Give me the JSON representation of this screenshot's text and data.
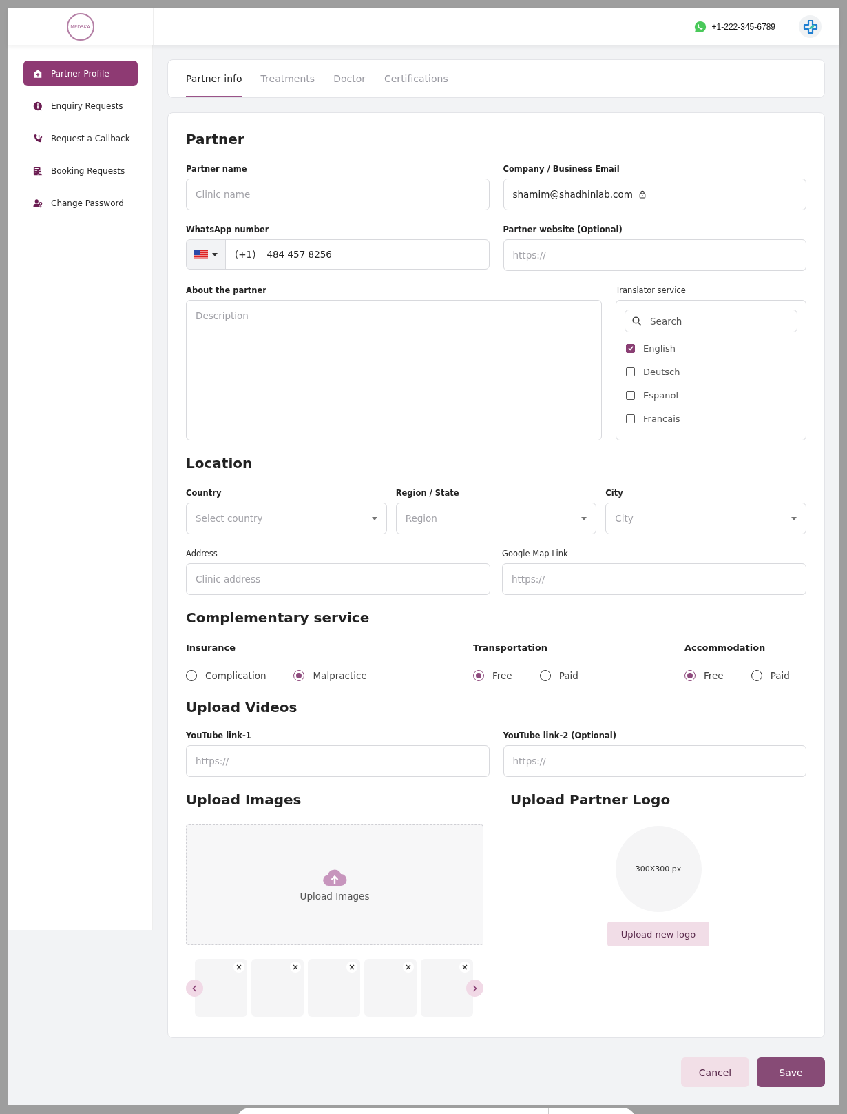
{
  "header": {
    "logo_text": "MEDSKA",
    "phone": "+1-222-345-6789"
  },
  "sidebar": {
    "items": [
      {
        "label": "Partner Profile",
        "selected": true
      },
      {
        "label": "Enquiry Requests",
        "selected": false
      },
      {
        "label": "Request a Callback",
        "selected": false
      },
      {
        "label": "Booking Requests",
        "selected": false
      },
      {
        "label": "Change Password",
        "selected": false
      }
    ]
  },
  "tabs": [
    {
      "label": "Partner info",
      "selected": true
    },
    {
      "label": "Treatments",
      "selected": false
    },
    {
      "label": "Doctor",
      "selected": false
    },
    {
      "label": "Certifications",
      "selected": false
    }
  ],
  "partner": {
    "title": "Partner",
    "name": {
      "label": "Partner name",
      "placeholder": "Clinic name"
    },
    "email": {
      "label": "Company / Business Email",
      "value": "shamim@shadhinlab.com",
      "locked": true
    },
    "whatsapp": {
      "label": "WhatsApp number",
      "code": "(+1)",
      "value": "484 457 8256"
    },
    "website": {
      "label": "Partner website (Optional)",
      "placeholder": "https://"
    },
    "about": {
      "label": "About the partner",
      "placeholder": "Description"
    },
    "translator": {
      "label": "Translator service",
      "search_placeholder": "Search",
      "languages": [
        {
          "label": "English",
          "checked": true
        },
        {
          "label": "Deutsch",
          "checked": false
        },
        {
          "label": "Espanol",
          "checked": false
        },
        {
          "label": "Francais",
          "checked": false
        }
      ]
    }
  },
  "location": {
    "title": "Location",
    "selects": [
      {
        "label": "Country",
        "placeholder": "Select country"
      },
      {
        "label": "Region / State",
        "placeholder": "Region"
      },
      {
        "label": "City",
        "placeholder": "City"
      }
    ],
    "address": {
      "label": "Address",
      "placeholder": "Clinic address"
    },
    "map_link": {
      "label": "Google Map Link",
      "placeholder": "https://"
    }
  },
  "complementary": {
    "title": "Complementary service",
    "groups": [
      {
        "label": "Insurance",
        "options": [
          {
            "label": "Complication",
            "selected": false
          },
          {
            "label": "Malpractice",
            "selected": true
          }
        ]
      },
      {
        "label": "Transportation",
        "options": [
          {
            "label": "Free",
            "selected": true
          },
          {
            "label": "Paid",
            "selected": false
          }
        ]
      },
      {
        "label": "Accommodation",
        "options": [
          {
            "label": "Free",
            "selected": true
          },
          {
            "label": "Paid",
            "selected": false
          }
        ]
      }
    ]
  },
  "videos": {
    "title": "Upload Videos",
    "links": [
      {
        "label": "YouTube link-1",
        "placeholder": "https://"
      },
      {
        "label": "YouTube link-2 (Optional)",
        "placeholder": "https://"
      }
    ]
  },
  "images": {
    "title": "Upload Images",
    "dropzone_label": "Upload Images",
    "thumbnails": [
      {
        "kind": "empty"
      },
      {
        "kind": "empty"
      },
      {
        "kind": "empty"
      },
      {
        "kind": "empty"
      },
      {
        "kind": "empty"
      }
    ]
  },
  "logo": {
    "title": "Upload Partner Logo",
    "size_hint": "300X300 px",
    "button": "Upload new logo"
  },
  "actions": [
    {
      "label": "Cancel",
      "kind": "secondary"
    },
    {
      "label": "Save",
      "kind": "primary"
    }
  ]
}
